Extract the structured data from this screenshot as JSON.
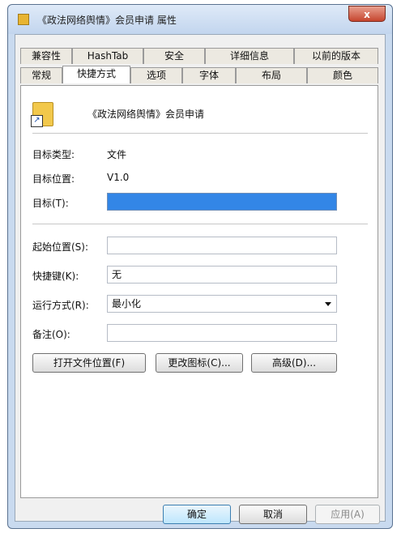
{
  "window": {
    "title": "《政法网络舆情》会员申请 属性",
    "close_glyph": "x"
  },
  "tabs_top": [
    "兼容性",
    "HashTab",
    "安全",
    "详细信息",
    "以前的版本"
  ],
  "tabs_bottom": [
    "常规",
    "快捷方式",
    "选项",
    "字体",
    "布局",
    "颜色"
  ],
  "active_tab": "快捷方式",
  "shortcut": {
    "name": "《政法网络舆情》会员申请",
    "target_type_label": "目标类型:",
    "target_type_value": "文件",
    "target_location_label": "目标位置:",
    "target_location_value": "V1.0",
    "target_label": "目标(T):",
    "target_value": "",
    "start_in_label": "起始位置(S):",
    "start_in_value": "",
    "hotkey_label": "快捷键(K):",
    "hotkey_value": "无",
    "run_label": "运行方式(R):",
    "run_value": "最小化",
    "comment_label": "备注(O):",
    "comment_value": ""
  },
  "panel_buttons": {
    "open_location": "打开文件位置(F)",
    "change_icon": "更改图标(C)...",
    "advanced": "高级(D)..."
  },
  "footer_buttons": {
    "ok": "确定",
    "cancel": "取消",
    "apply": "应用(A)"
  },
  "colors": {
    "selection": "#3386e6",
    "titlebar": "#c9daef",
    "close": "#c6452e"
  }
}
